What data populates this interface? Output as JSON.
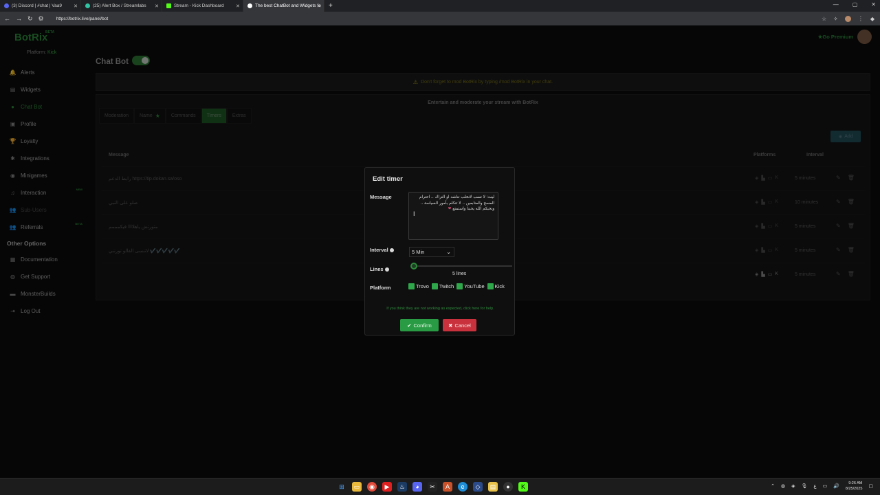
{
  "browser": {
    "tabs": [
      {
        "title": "(3) Discord | #chat | Vaa9",
        "color": "#5865f2",
        "active": false
      },
      {
        "title": "(25) Alert Box / Streamlabs",
        "color": "#31c3a2",
        "active": false
      },
      {
        "title": "Stream - Kick Dashboard",
        "color": "#53fc18",
        "active": false
      },
      {
        "title": "The best ChatBot and Widgets fo",
        "color": "#ffffff",
        "active": true
      }
    ],
    "url": "https://botrix.live/panel/bot"
  },
  "brand": {
    "name": "BotRix",
    "beta": "BETA",
    "platform_label": "Platform:",
    "platform_value": "Kick"
  },
  "header": {
    "go_premium": "Go Premium"
  },
  "sidebar": {
    "items": [
      {
        "label": "Alerts",
        "icon": "bell-icon",
        "glyph": "🔔"
      },
      {
        "label": "Widgets",
        "icon": "widgets-icon",
        "glyph": "▤"
      },
      {
        "label": "Chat Bot",
        "icon": "chatbot-icon",
        "glyph": "●"
      },
      {
        "label": "Profile",
        "icon": "profile-icon",
        "glyph": "▣"
      },
      {
        "label": "Loyalty",
        "icon": "trophy-icon",
        "glyph": "🏆"
      },
      {
        "label": "Integrations",
        "icon": "puzzle-icon",
        "glyph": "✱"
      },
      {
        "label": "Minigames",
        "icon": "gamepad-icon",
        "glyph": "◉"
      },
      {
        "label": "Interaction",
        "icon": "music-icon",
        "glyph": "♫",
        "badge": "NEW"
      },
      {
        "label": "Sub-Users",
        "icon": "users-icon",
        "glyph": "👥"
      },
      {
        "label": "Referrals",
        "icon": "referrals-icon",
        "glyph": "👥",
        "badge": "BETA"
      }
    ],
    "other_title": "Other Options",
    "other_items": [
      {
        "label": "Documentation",
        "icon": "book-icon",
        "glyph": "▦"
      },
      {
        "label": "Get Support",
        "icon": "support-icon",
        "glyph": "◍"
      },
      {
        "label": "MonsterBuilds",
        "icon": "monster-icon",
        "glyph": "▬"
      },
      {
        "label": "Log Out",
        "icon": "logout-icon",
        "glyph": "⇥"
      }
    ]
  },
  "page": {
    "title": "Chat Bot",
    "notice": "Don't forget to mod BotRix by typing /mod BotRix in your chat.",
    "panel_heading": "Entertain and moderate your stream with BotRix",
    "tabs": [
      "Moderation",
      "Name",
      "Commands",
      "Timers",
      "Extras"
    ],
    "add_label": "Add",
    "columns": {
      "message": "Message",
      "platforms": "Platforms",
      "interval": "Interval"
    },
    "rows": [
      {
        "message": "رابط الدعم https://tip.dokan.sa/oso",
        "interval": "5 minutes"
      },
      {
        "message": "صلو على النبي",
        "interval": "10 minutes"
      },
      {
        "message": "متورتش ياهلاااا فيكمممم",
        "interval": "5 minutes"
      },
      {
        "message": "لاتنسى الفالو تورتني ✔️✔️✔️✔️✔️",
        "interval": "5 minutes"
      },
      {
        "message": "",
        "interval": "5 minutes"
      }
    ]
  },
  "modal": {
    "title": "Edit timer",
    "message_label": "Message",
    "message_value": "ليت: لا تسب لاتخلب تناشد او التراك .. احترام المسح والمتابعين .. لا تتكلم بأمور السياسة .. ونحبكم الله يحبنا واستمتع",
    "heart": "❤",
    "interval_label": "Interval",
    "interval_value": "5 Min",
    "lines_label": "Lines",
    "lines_value": "5 lines",
    "lines_fraction": 0.0,
    "platform_label": "Platform",
    "platforms": [
      "Trovo",
      "Twitch",
      "YouTube",
      "Kick"
    ],
    "help_text": "If you think they are not working as expected, click here for help.",
    "confirm": "Confirm",
    "cancel": "Cancel"
  },
  "taskbar": {
    "time": "9:26 AM",
    "date": "8/25/2025"
  },
  "colors": {
    "accent": "#2e8b3c",
    "confirm": "#2a9b45",
    "cancel": "#c9323d"
  }
}
